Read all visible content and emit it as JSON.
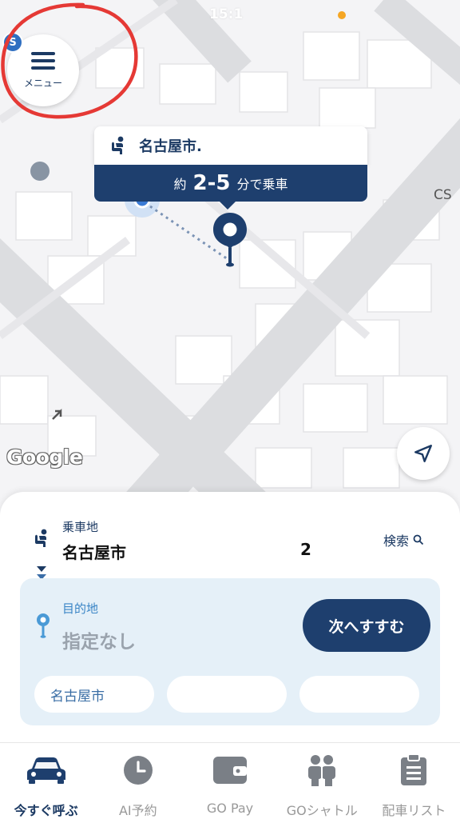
{
  "status": {
    "time": "15:1"
  },
  "menu": {
    "label": "メニュー",
    "avatar_letter": "S"
  },
  "map": {
    "pickup_card": {
      "name": "名古屋市.",
      "eta_prefix": "約",
      "eta_range": "2-5",
      "eta_suffix": "分で乗車"
    },
    "poi_label": "CS",
    "attribution": "Google"
  },
  "sheet": {
    "pickup": {
      "label": "乗車地",
      "address": "名古屋市",
      "address_tail": "2",
      "search_label": "検索"
    },
    "destination": {
      "label": "目的地",
      "value": "指定なし",
      "next_button": "次へすすむ"
    },
    "suggestions": [
      "名古屋市",
      "",
      ""
    ]
  },
  "tabs": [
    {
      "label": "今すぐ呼ぶ",
      "icon": "taxi-icon",
      "active": true
    },
    {
      "label": "AI予約",
      "icon": "clock-icon",
      "active": false
    },
    {
      "label": "GO Pay",
      "icon": "wallet-icon",
      "active": false
    },
    {
      "label": "GOシャトル",
      "icon": "people-icon",
      "active": false
    },
    {
      "label": "配車リスト",
      "icon": "clipboard-icon",
      "active": false
    }
  ],
  "colors": {
    "primary": "#1e3f6e",
    "accent": "#3a85c6",
    "annotation": "#e53935"
  }
}
